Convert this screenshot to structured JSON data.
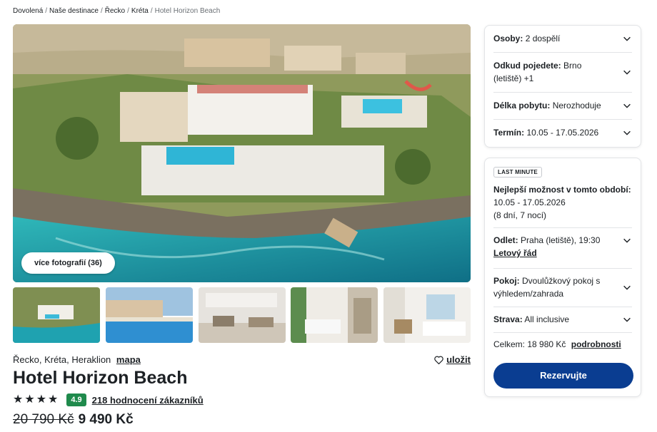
{
  "breadcrumb": {
    "items": [
      "Dovolená",
      "Naše destinace",
      "Řecko",
      "Kréta"
    ],
    "current": "Hotel Horizon Beach",
    "separator": "/"
  },
  "gallery": {
    "more_photos_label": "více fotografií (36)",
    "thumbnails": [
      "aerial-view",
      "pool-sunset",
      "lobby",
      "room-twin",
      "room-balcony"
    ]
  },
  "hotel": {
    "location": "Řecko, Kréta, Heraklion",
    "map_label": "mapa",
    "save_label": "uložit",
    "name": "Hotel Horizon Beach",
    "stars": 4,
    "score": "4.9",
    "reviews_label": "218 hodnocení zákazníků",
    "old_price": "20 790 Kč",
    "price": "9 490 Kč"
  },
  "search": {
    "persons_label": "Osoby:",
    "persons_value": "2 dospělí",
    "departure_label": "Odkud pojedete:",
    "departure_value": "Brno",
    "departure_value_2": "(letiště) +1",
    "length_label": "Délka pobytu:",
    "length_value": "Nerozhoduje",
    "term_label": "Termín:",
    "term_value": "10.05 - 17.05.2026"
  },
  "offer": {
    "badge": "LAST MINUTE",
    "best_title": "Nejlepší možnost v tomto období:",
    "best_dates": "10.05 - 17.05.2026",
    "best_length": "(8 dní, 7 nocí)",
    "departure_label": "Odlet:",
    "departure_value": "Praha (letiště), 19:30",
    "schedule_link": "Letový řád",
    "room_label": "Pokoj:",
    "room_value": "Dvoulůžkový pokoj s",
    "room_value_2": "výhledem/zahrada",
    "board_label": "Strava:",
    "board_value": "All inclusive",
    "total_label": "Celkem:",
    "total_value": "18 980 Kč",
    "details_link": "podrobnosti",
    "book_label": "Rezervujte"
  },
  "colors": {
    "primary": "#0a3d91",
    "score_green": "#1f8a4c",
    "sea": "#1aa6b0"
  }
}
